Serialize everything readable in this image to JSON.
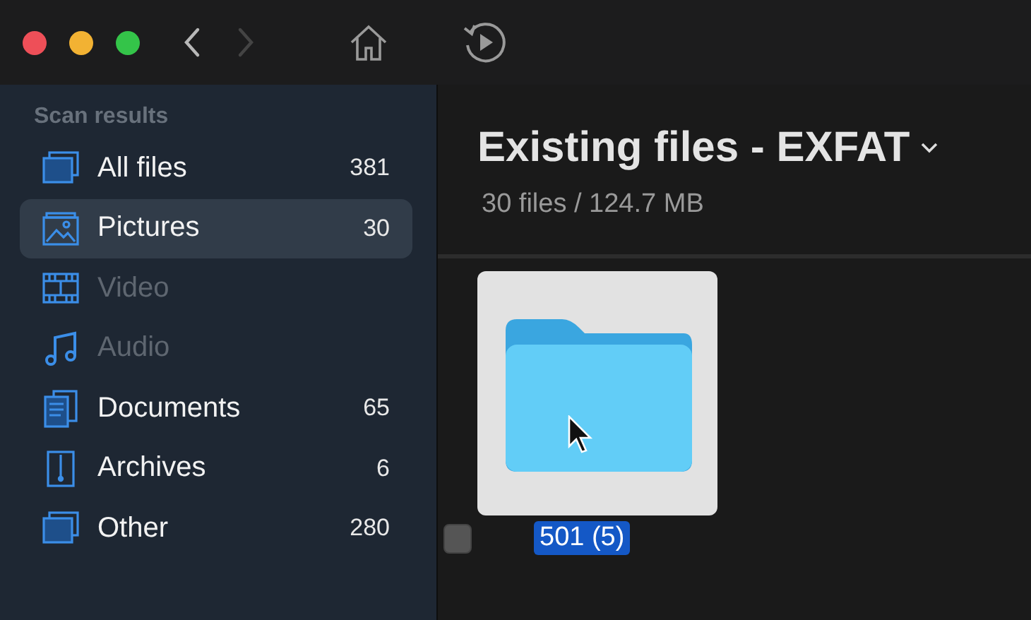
{
  "toolbar": {
    "back": {
      "disabled": false
    },
    "forward": {
      "disabled": true
    }
  },
  "sidebar": {
    "heading": "Scan results",
    "items": [
      {
        "kind": "all",
        "label": "All files",
        "count": "381",
        "selected": false,
        "disabled": false
      },
      {
        "kind": "pictures",
        "label": "Pictures",
        "count": "30",
        "selected": true,
        "disabled": false
      },
      {
        "kind": "video",
        "label": "Video",
        "selected": false,
        "disabled": true
      },
      {
        "kind": "audio",
        "label": "Audio",
        "selected": false,
        "disabled": true
      },
      {
        "kind": "documents",
        "label": "Documents",
        "count": "65",
        "selected": false,
        "disabled": false
      },
      {
        "kind": "archives",
        "label": "Archives",
        "count": "6",
        "selected": false,
        "disabled": false
      },
      {
        "kind": "other",
        "label": "Other",
        "count": "280",
        "selected": false,
        "disabled": false
      }
    ]
  },
  "content": {
    "title": "Existing files - EXFAT",
    "subtitle": "30 files / 124.7 MB",
    "files": [
      {
        "name": "501 (5)",
        "selected": true,
        "checked": false
      }
    ]
  }
}
